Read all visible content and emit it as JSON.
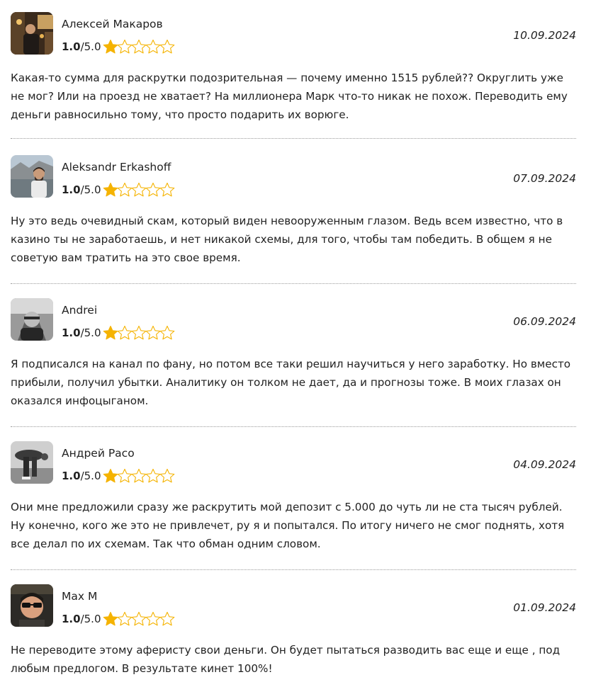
{
  "star_color": "#f5b301",
  "reviews": [
    {
      "author": "Алексей Макаров",
      "score": "1.0",
      "max": "/5.0",
      "stars_filled": 1,
      "stars_total": 5,
      "date": "10.09.2024",
      "text": "Какая-то сумма для раскрутки подозрительная — почему именно 1515 рублей?? Округлить уже не мог? Или на проезд не хватает? На миллионера Марк что-то никак не похож. Переводить ему деньги равносильно тому, что просто подарить их ворюге."
    },
    {
      "author": "Aleksandr Erkashoff",
      "score": "1.0",
      "max": "/5.0",
      "stars_filled": 1,
      "stars_total": 5,
      "date": "07.09.2024",
      "text": "Ну это ведь очевидный скам, который виден невооруженным глазом. Ведь всем известно, что в казино ты не заработаешь, и нет никакой схемы, для того, чтобы там победить. В общем я не советую вам тратить на это свое время."
    },
    {
      "author": "Andrei",
      "score": "1.0",
      "max": "/5.0",
      "stars_filled": 1,
      "stars_total": 5,
      "date": "06.09.2024",
      "text": "Я подписался на канал по фану, но потом все таки решил научиться у него заработку. Но вместо прибыли, получил убытки. Аналитику он толком не дает, да и прогнозы тоже. В моих глазах он оказался инфоцыганом."
    },
    {
      "author": "Андрей Расо",
      "score": "1.0",
      "max": "/5.0",
      "stars_filled": 1,
      "stars_total": 5,
      "date": "04.09.2024",
      "text": "Они мне предложили сразу же раскрутить мой депозит с 5.000 до чуть ли не ста тысяч рублей. Ну конечно, кого же это не привлечет, ру я и попытался. По итогу ничего не смог поднять, хотя все делал по их схемам. Так что обман одним словом."
    },
    {
      "author": "Max M",
      "score": "1.0",
      "max": "/5.0",
      "stars_filled": 1,
      "stars_total": 5,
      "date": "01.09.2024",
      "text": "Не переводите этому аферисту свои деньги. Он будет пытаться разводить вас еще и еще , под любым предлогом. В результате кинет 100%!"
    }
  ]
}
